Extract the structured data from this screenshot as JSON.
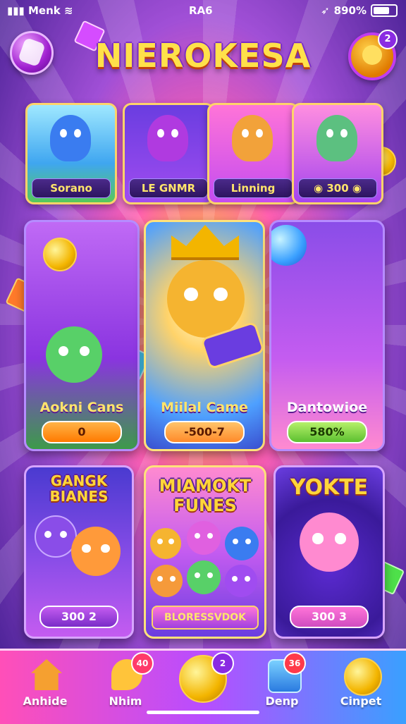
{
  "status_bar": {
    "carrier": "Menk",
    "time": "RA6",
    "battery": "890%"
  },
  "header": {
    "title": "NIEROKESA",
    "profile_badge": "2"
  },
  "top_cards": [
    {
      "label": "Sorano"
    },
    {
      "label": "LE GNMR"
    },
    {
      "label": "Linning"
    },
    {
      "label": "300"
    }
  ],
  "middle_cards": [
    {
      "label": "Aokni Cans",
      "value": "0"
    },
    {
      "label": "Miilal Came",
      "value": "-500-7"
    },
    {
      "label": "Dantowioe",
      "value": "580%"
    }
  ],
  "bottom_cards": [
    {
      "title": "GANGK BIANES",
      "value": "300 2"
    },
    {
      "title": "MIAMOKT FUNES",
      "value": "BLORESSVDOK"
    },
    {
      "title": "YOKTE",
      "value": "300 3"
    }
  ],
  "nav": {
    "items": [
      {
        "label": "Anhide",
        "icon": "home-icon",
        "badge": ""
      },
      {
        "label": "Nhim",
        "icon": "chat-icon",
        "badge": "40"
      },
      {
        "label": "",
        "icon": "coin-icon",
        "badge": "2"
      },
      {
        "label": "Denp",
        "icon": "shop-icon",
        "badge": "36"
      },
      {
        "label": "Cinpet",
        "icon": "trophy-icon",
        "badge": ""
      }
    ]
  }
}
